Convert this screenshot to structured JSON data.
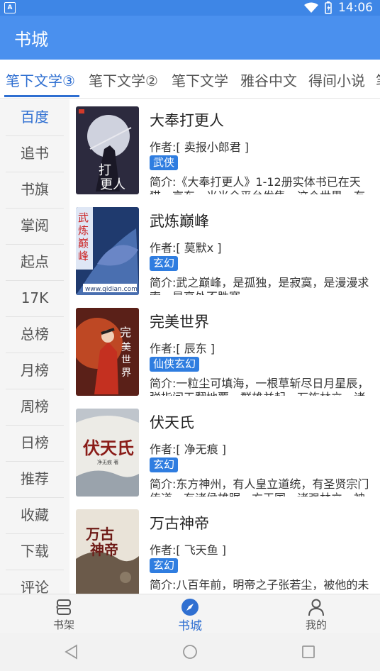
{
  "status": {
    "time": "14:06"
  },
  "appbar": {
    "title": "书城"
  },
  "tabs": [
    "笔下文学③",
    "笔下文学②",
    "笔下文学",
    "雅谷中文",
    "得间小说",
    "笔"
  ],
  "sidebar": [
    "百度",
    "追书",
    "书旗",
    "掌阅",
    "起点",
    "17K",
    "总榜",
    "月榜",
    "周榜",
    "日榜",
    "推荐",
    "收藏",
    "下载",
    "评论"
  ],
  "books": [
    {
      "title": "大奉打更人",
      "author": "作者:[ 卖报小郎君 ]",
      "tag": "武侠",
      "intro": "简介:《大奉打更人》1-12册实体书已在天猫、京东、当当全平台发售。这个世界，有",
      "cover": {
        "icon": "cover-moon-warrior",
        "accent": "#3a3550",
        "cover_text": "打更人",
        "badge": "起点中文网"
      }
    },
    {
      "title": "武炼巅峰",
      "author": "作者:[ 莫默x ]",
      "tag": "玄幻",
      "intro": "简介:武之巅峰，是孤独，是寂寞，是漫漫求索，是高处不胜寒",
      "cover": {
        "icon": "cover-dragon",
        "accent": "#2c4b86",
        "cover_text": "武炼巅峰",
        "badge": "www.qidian.com"
      }
    },
    {
      "title": "完美世界",
      "author": "作者:[ 辰东 ]",
      "tag": "仙侠玄幻",
      "intro": "简介:一粒尘可填海，一根草斩尽日月星辰，弹指间天翻地覆。群雄并起，万族林立，诸",
      "cover": {
        "icon": "cover-red-hero",
        "accent": "#b23a2a",
        "cover_text": "完美世界",
        "badge": ""
      }
    },
    {
      "title": "伏天氏",
      "author": "作者:[ 净无痕 ]",
      "tag": "玄幻",
      "intro": "简介:东方神州，有人皇立道统，有圣贤宗门传道，有诸侯雄踞一方王国，诸强林立，神",
      "cover": {
        "icon": "cover-ink-title",
        "accent": "#9a2a24",
        "cover_text": "伏天氏",
        "badge": "净无痕 著"
      }
    },
    {
      "title": "万古神帝",
      "author": "作者:[ 飞天鱼 ]",
      "tag": "玄幻",
      "intro": "简介:八百年前，明帝之子张若尘，被他的未",
      "cover": {
        "icon": "cover-ink-title",
        "accent": "#7a1f1a",
        "cover_text": "万古神帝",
        "badge": ""
      }
    }
  ],
  "bottom_nav": [
    {
      "label": "书架",
      "icon": "bookshelf-icon"
    },
    {
      "label": "书城",
      "icon": "compass-icon"
    },
    {
      "label": "我的",
      "icon": "person-icon"
    }
  ],
  "colors": {
    "primary": "#4a90ee",
    "active": "#2f6fd1",
    "tag": "#2f7de0"
  }
}
